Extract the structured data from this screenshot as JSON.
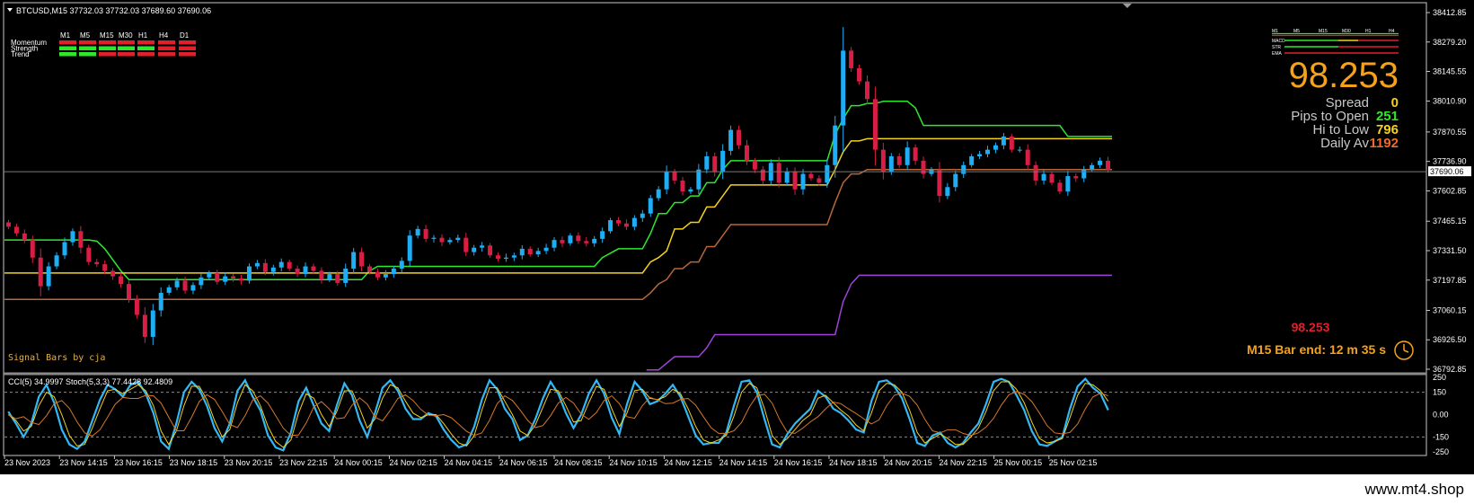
{
  "header": {
    "symbol_line": "BTCUSD,M15  37732.03 37732.03 37689.60 37690.06"
  },
  "signal_panel": {
    "timeframes": [
      "M1",
      "M5",
      "M15",
      "M30",
      "H1",
      "H4",
      "D1"
    ],
    "rows": [
      {
        "label": "Momentum",
        "states": [
          "red",
          "red",
          "red",
          "red",
          "red",
          "red",
          "red"
        ]
      },
      {
        "label": "Strength",
        "states": [
          "green",
          "green",
          "green",
          "green",
          "green",
          "red",
          "red"
        ]
      },
      {
        "label": "Trend",
        "states": [
          "green",
          "green",
          "red",
          "red",
          "red",
          "red",
          "red"
        ]
      }
    ],
    "credit": "Signal Bars by cja",
    "colors": {
      "red": "#e0202a",
      "green": "#2ee82e"
    }
  },
  "mini_panel": {
    "headers": [
      "M1",
      "M5",
      "M15",
      "M30",
      "H1",
      "H4"
    ],
    "rows": [
      "MACD",
      "STR",
      "EMA"
    ]
  },
  "info": {
    "big_value": "98.253",
    "spread_label": "Spread",
    "spread_value": "0",
    "pips_label": "Pips to Open",
    "pips_value": "251",
    "hilo_label": "Hi to Low",
    "hilo_value": "796",
    "daily_label": "Daily Av",
    "daily_value": "1192",
    "small_value": "98.253",
    "bar_end": "M15 Bar end: 12 m 35 s"
  },
  "oscillator": {
    "label": "CCI(5) 34.9997  Stoch(5,3,3) 77.4428 92.4809"
  },
  "watermark": "www.mt4.shop",
  "chart_data": [
    {
      "type": "candlestick",
      "title": "BTCUSD,M15",
      "y_ticks": [
        "38412.85",
        "38279.20",
        "38145.55",
        "38010.90",
        "37870.55",
        "37736.90",
        "37602.85",
        "37465.15",
        "37331.50",
        "37197.85",
        "37060.15",
        "36926.50",
        "36792.85"
      ],
      "ylim": [
        36792.85,
        38412.85
      ],
      "current_price": "37690.06",
      "x_ticks": [
        "23 Nov 2023",
        "23 Nov 14:15",
        "23 Nov 16:15",
        "23 Nov 18:15",
        "23 Nov 20:15",
        "23 Nov 22:15",
        "24 Nov 00:15",
        "24 Nov 02:15",
        "24 Nov 04:15",
        "24 Nov 06:15",
        "24 Nov 08:15",
        "24 Nov 10:15",
        "24 Nov 12:15",
        "24 Nov 14:15",
        "24 Nov 16:15",
        "24 Nov 18:15",
        "24 Nov 20:15",
        "24 Nov 22:15",
        "25 Nov 00:15",
        "25 Nov 02:15"
      ],
      "closes": [
        37440,
        37410,
        37380,
        37300,
        37170,
        37260,
        37310,
        37370,
        37420,
        37345,
        37280,
        37270,
        37240,
        37215,
        37180,
        37110,
        37040,
        36940,
        37060,
        37140,
        37165,
        37195,
        37150,
        37175,
        37210,
        37230,
        37190,
        37215,
        37205,
        37195,
        37260,
        37275,
        37235,
        37255,
        37280,
        37250,
        37225,
        37260,
        37240,
        37200,
        37225,
        37185,
        37250,
        37325,
        37260,
        37235,
        37210,
        37225,
        37250,
        37285,
        37400,
        37430,
        37385,
        37390,
        37370,
        37380,
        37390,
        37325,
        37345,
        37355,
        37310,
        37295,
        37300,
        37310,
        37340,
        37315,
        37330,
        37345,
        37380,
        37365,
        37400,
        37375,
        37365,
        37385,
        37420,
        37470,
        37455,
        37440,
        37480,
        37500,
        37570,
        37610,
        37690,
        37650,
        37600,
        37610,
        37700,
        37760,
        37690,
        37785,
        37880,
        37810,
        37740,
        37700,
        37650,
        37730,
        37640,
        37690,
        37610,
        37680,
        37660,
        37640,
        37720,
        37900,
        38240,
        38160,
        38100,
        38020,
        37790,
        37690,
        37760,
        37720,
        37800,
        37740,
        37680,
        37700,
        37580,
        37620,
        37680,
        37720,
        37760,
        37770,
        37790,
        37810,
        37850,
        37790,
        37790,
        37720,
        37650,
        37680,
        37640,
        37600,
        37670,
        37660,
        37700,
        37720,
        37740,
        37700
      ],
      "series": [
        {
          "name": "green",
          "values": [
            37380,
            37380,
            37380,
            37380,
            37380,
            37380,
            37380,
            37380,
            37380,
            37380,
            37380,
            37375,
            37340,
            37290,
            37240,
            37200,
            37200,
            37200,
            37200,
            37200,
            37200,
            37200,
            37200,
            37200,
            37200,
            37200,
            37200,
            37200,
            37200,
            37200,
            37200,
            37200,
            37200,
            37200,
            37200,
            37200,
            37200,
            37200,
            37200,
            37200,
            37200,
            37200,
            37200,
            37200,
            37200,
            37240,
            37260,
            37260,
            37260,
            37260,
            37260,
            37260,
            37260,
            37260,
            37260,
            37260,
            37260,
            37260,
            37260,
            37260,
            37260,
            37260,
            37260,
            37260,
            37260,
            37260,
            37260,
            37260,
            37260,
            37260,
            37260,
            37260,
            37260,
            37260,
            37300,
            37320,
            37340,
            37340,
            37340,
            37340,
            37410,
            37500,
            37500,
            37550,
            37550,
            37580,
            37580,
            37640,
            37640,
            37700,
            37740,
            37740,
            37740,
            37740,
            37740,
            37740,
            37740,
            37740,
            37740,
            37740,
            37740,
            37740,
            37740,
            37860,
            37930,
            37990,
            37990,
            38000,
            38000,
            38010,
            38010,
            38010,
            38010,
            37980,
            37900,
            37900,
            37900,
            37900,
            37900,
            37900,
            37900,
            37900,
            37900,
            37900,
            37900,
            37900,
            37900,
            37900,
            37900,
            37900,
            37900,
            37900,
            37850,
            37850,
            37850,
            37850,
            37850,
            37850
          ]
        },
        {
          "name": "yellow",
          "values": [
            37230,
            37230,
            37230,
            37230,
            37230,
            37230,
            37230,
            37230,
            37230,
            37230,
            37230,
            37230,
            37230,
            37230,
            37230,
            37230,
            37230,
            37230,
            37230,
            37230,
            37230,
            37230,
            37230,
            37230,
            37230,
            37230,
            37230,
            37230,
            37230,
            37230,
            37230,
            37230,
            37230,
            37230,
            37230,
            37230,
            37230,
            37230,
            37230,
            37230,
            37230,
            37230,
            37230,
            37230,
            37230,
            37230,
            37230,
            37230,
            37230,
            37230,
            37230,
            37230,
            37230,
            37230,
            37230,
            37230,
            37230,
            37230,
            37230,
            37230,
            37230,
            37230,
            37230,
            37230,
            37230,
            37230,
            37230,
            37230,
            37230,
            37230,
            37230,
            37230,
            37230,
            37230,
            37230,
            37230,
            37230,
            37230,
            37230,
            37230,
            37280,
            37300,
            37330,
            37430,
            37430,
            37460,
            37460,
            37530,
            37530,
            37580,
            37630,
            37630,
            37630,
            37630,
            37630,
            37630,
            37630,
            37630,
            37630,
            37630,
            37630,
            37630,
            37630,
            37700,
            37780,
            37830,
            37830,
            37840,
            37840,
            37840,
            37840,
            37840,
            37840,
            37840,
            37840,
            37840,
            37840,
            37840,
            37840,
            37840,
            37840,
            37840,
            37840,
            37840,
            37840,
            37840,
            37840,
            37840,
            37840,
            37840,
            37840,
            37840,
            37840,
            37840,
            37840,
            37840,
            37840,
            37840
          ]
        },
        {
          "name": "brown",
          "values": [
            37110,
            37110,
            37110,
            37110,
            37110,
            37110,
            37110,
            37110,
            37110,
            37110,
            37110,
            37110,
            37110,
            37110,
            37110,
            37110,
            37110,
            37110,
            37110,
            37110,
            37110,
            37110,
            37110,
            37110,
            37110,
            37110,
            37110,
            37110,
            37110,
            37110,
            37110,
            37110,
            37110,
            37110,
            37110,
            37110,
            37110,
            37110,
            37110,
            37110,
            37110,
            37110,
            37110,
            37110,
            37110,
            37110,
            37110,
            37110,
            37110,
            37110,
            37110,
            37110,
            37110,
            37110,
            37110,
            37110,
            37110,
            37110,
            37110,
            37110,
            37110,
            37110,
            37110,
            37110,
            37110,
            37110,
            37110,
            37110,
            37110,
            37110,
            37110,
            37110,
            37110,
            37110,
            37110,
            37110,
            37110,
            37110,
            37110,
            37110,
            37140,
            37180,
            37200,
            37250,
            37250,
            37280,
            37280,
            37350,
            37350,
            37400,
            37450,
            37450,
            37450,
            37450,
            37450,
            37450,
            37450,
            37450,
            37450,
            37450,
            37450,
            37450,
            37450,
            37550,
            37640,
            37680,
            37680,
            37700,
            37700,
            37700,
            37700,
            37700,
            37700,
            37700,
            37700,
            37700,
            37700,
            37700,
            37700,
            37700,
            37700,
            37700,
            37700,
            37700,
            37700,
            37700,
            37700,
            37700,
            37700,
            37700,
            37700,
            37700,
            37700,
            37700,
            37700,
            37700,
            37700,
            37700
          ]
        },
        {
          "name": "purple",
          "start_index": 80,
          "values": [
            36790,
            36790,
            36820,
            36850,
            36850,
            36850,
            36850,
            36890,
            36950,
            36950,
            36950,
            36950,
            36950,
            36950,
            36950,
            36950,
            36950,
            36950,
            36950,
            36950,
            36950,
            36950,
            36950,
            36950,
            37100,
            37180,
            37220,
            37220,
            37220,
            37220,
            37220,
            37220,
            37220,
            37220,
            37220,
            37220,
            37220,
            37220,
            37220,
            37220,
            37220,
            37220,
            37220,
            37220,
            37220,
            37220,
            37220,
            37220,
            37220,
            37220,
            37220,
            37220,
            37220,
            37220,
            37220,
            37220,
            37220,
            37220
          ]
        }
      ]
    },
    {
      "type": "line",
      "title": "CCI(5) Stoch(5,3,3)",
      "y_ticks": [
        "250",
        "150",
        "0.00",
        "-150",
        "-250"
      ],
      "ylim": [
        -250,
        250
      ],
      "series": [
        {
          "name": "CCI(5)",
          "values": [
            20,
            -60,
            -150,
            -60,
            120,
            200,
            80,
            -100,
            -200,
            -230,
            -180,
            -40,
            100,
            200,
            170,
            120,
            200,
            220,
            140,
            10,
            -180,
            -230,
            -60,
            150,
            220,
            170,
            60,
            -90,
            -180,
            -60,
            160,
            230,
            120,
            30,
            -140,
            -220,
            -240,
            -120,
            90,
            180,
            60,
            -60,
            -110,
            60,
            210,
            130,
            -40,
            -150,
            10,
            180,
            230,
            160,
            40,
            -30,
            -30,
            10,
            -10,
            -100,
            -170,
            -220,
            -200,
            -80,
            100,
            230,
            170,
            40,
            -30,
            -170,
            -140,
            -30,
            110,
            220,
            140,
            10,
            -90,
            0,
            140,
            230,
            140,
            -20,
            -130,
            70,
            220,
            160,
            70,
            90,
            140,
            200,
            120,
            -10,
            -140,
            -200,
            -190,
            -190,
            -120,
            60,
            220,
            230,
            150,
            -30,
            -200,
            -220,
            -130,
            -60,
            -10,
            40,
            160,
            120,
            40,
            10,
            -40,
            -100,
            -120,
            90,
            220,
            230,
            190,
            110,
            -30,
            -190,
            -210,
            -140,
            -120,
            -190,
            -220,
            -190,
            -120,
            -60,
            70,
            220,
            240,
            220,
            130,
            30,
            -110,
            -200,
            -210,
            -180,
            -150,
            40,
            190,
            240,
            180,
            140,
            30
          ]
        },
        {
          "name": "Stoch(5,3,3)",
          "values": [
            0,
            -40,
            -110,
            -80,
            60,
            150,
            120,
            0,
            -140,
            -210,
            -200,
            -90,
            40,
            160,
            170,
            140,
            170,
            200,
            160,
            60,
            -110,
            -200,
            -110,
            60,
            190,
            190,
            100,
            -40,
            -150,
            -100,
            80,
            200,
            160,
            60,
            -80,
            -180,
            -220,
            -170,
            10,
            140,
            110,
            0,
            -80,
            20,
            160,
            160,
            40,
            -90,
            -30,
            110,
            200,
            180,
            90,
            10,
            -20,
            0,
            0,
            -60,
            -130,
            -190,
            -210,
            -140,
            30,
            180,
            180,
            90,
            0,
            -110,
            -140,
            -70,
            50,
            170,
            160,
            60,
            -50,
            -40,
            80,
            190,
            170,
            40,
            -80,
            10,
            160,
            170,
            110,
            100,
            120,
            170,
            140,
            40,
            -80,
            -170,
            -190,
            -170,
            -140,
            -10,
            150,
            210,
            180,
            40,
            -140,
            -200,
            -160,
            -100,
            -40,
            0,
            110,
            130,
            80,
            30,
            -10,
            -70,
            -110,
            10,
            160,
            210,
            200,
            150,
            30,
            -120,
            -190,
            -160,
            -130,
            -160,
            -200,
            -200,
            -150,
            -90,
            20,
            160,
            220,
            220,
            170,
            80,
            -50,
            -160,
            -190,
            -180,
            -160,
            -20,
            130,
            210,
            200,
            160,
            90
          ]
        }
      ]
    }
  ]
}
